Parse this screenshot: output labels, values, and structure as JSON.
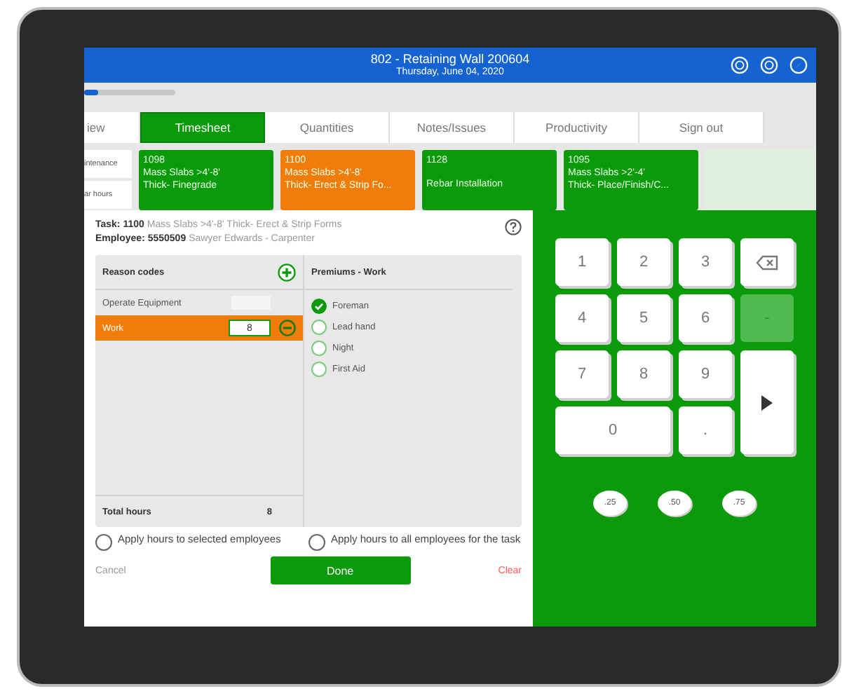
{
  "header": {
    "title": "802 - Retaining Wall 200604",
    "subtitle": "Thursday, June 04, 2020"
  },
  "progress": {
    "level": 0.15
  },
  "tabs": [
    {
      "label": "iew",
      "selected": false
    },
    {
      "label": "Timesheet",
      "selected": true
    },
    {
      "label": "Quantities",
      "selected": false
    },
    {
      "label": "Notes/Issues",
      "selected": false
    },
    {
      "label": "Productivity",
      "selected": false
    },
    {
      "label": "Sign out",
      "selected": false
    }
  ],
  "side_buttons": [
    "intenance",
    "ar hours"
  ],
  "task_cards": [
    {
      "lines": [
        "1098",
        "Mass Slabs >4'-8'",
        "Thick- Finegrade"
      ],
      "selected": false
    },
    {
      "lines": [
        "1100",
        "Mass Slabs >4'-8'",
        "Thick- Erect & Strip Fo..."
      ],
      "selected": true
    },
    {
      "lines": [
        "1128",
        "Rebar Installation"
      ],
      "selected": false
    },
    {
      "lines": [
        "1095",
        "Mass Slabs >2'-4'",
        "Thick- Place/Finish/C..."
      ],
      "selected": false
    }
  ],
  "dialog": {
    "task_label": "Task: 1100",
    "task_name": "Mass Slabs >4'-8' Thick- Erect & Strip Forms",
    "employee_label": "Employee: 5550509",
    "employee_name": "Sawyer Edwards - Carpenter",
    "reason_header": "Reason codes",
    "reasons": [
      {
        "name": "Operate Equipment",
        "selected": false
      },
      {
        "name": "Work",
        "hours": "8",
        "selected": true
      }
    ],
    "total_label": "Total hours",
    "total_value": "8",
    "premiums_header": "Premiums - Work",
    "premiums": [
      {
        "label": "Foreman",
        "checked": true
      },
      {
        "label": "Lead hand",
        "checked": false
      },
      {
        "label": "Night",
        "checked": false
      },
      {
        "label": "First Aid",
        "checked": false
      }
    ],
    "apply_options": [
      {
        "label": "Apply hours to selected employees",
        "checked": false
      },
      {
        "label": "Apply hours to all employees for the task",
        "checked": false
      }
    ],
    "cancel": "Cancel",
    "done": "Done",
    "clear": "Clear"
  },
  "keypad": {
    "keys": [
      {
        "kind": "digit",
        "label": "1",
        "disabled": false
      },
      {
        "kind": "digit",
        "label": "2",
        "disabled": false
      },
      {
        "kind": "digit",
        "label": "3",
        "disabled": false
      },
      {
        "kind": "backspace",
        "disabled": false
      },
      {
        "kind": "digit",
        "label": "4",
        "disabled": false
      },
      {
        "kind": "digit",
        "label": "5",
        "disabled": false
      },
      {
        "kind": "digit",
        "label": "6",
        "disabled": false
      },
      {
        "kind": "digit",
        "label": "-",
        "disabled": true
      },
      {
        "kind": "digit",
        "label": "7",
        "disabled": false
      },
      {
        "kind": "digit",
        "label": "8",
        "disabled": false
      },
      {
        "kind": "digit",
        "label": "9",
        "disabled": false
      },
      {
        "kind": "enter",
        "disabled": false
      },
      {
        "kind": "wide",
        "label": "0",
        "disabled": false
      },
      {
        "kind": "digit",
        "label": ".",
        "disabled": false
      }
    ],
    "quick": [
      ".25",
      ".50",
      ".75"
    ]
  }
}
